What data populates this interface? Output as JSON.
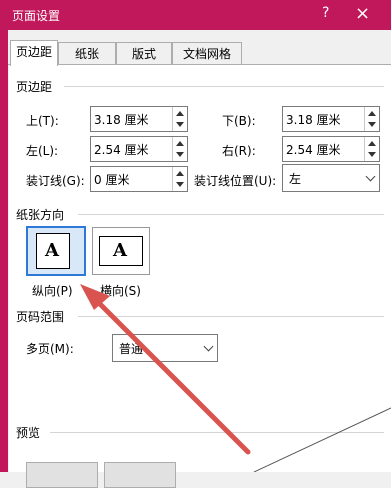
{
  "window": {
    "title": "页面设置",
    "help_glyph": "?",
    "close_glyph": "×"
  },
  "tabs": [
    {
      "label": "页边距",
      "active": true
    },
    {
      "label": "纸张",
      "active": false
    },
    {
      "label": "版式",
      "active": false
    },
    {
      "label": "文档网格",
      "active": false
    }
  ],
  "margins": {
    "group_label": "页边距",
    "top": {
      "label": "上(T):",
      "value": "3.18 厘米"
    },
    "bottom": {
      "label": "下(B):",
      "value": "3.18 厘米"
    },
    "left": {
      "label": "左(L):",
      "value": "2.54 厘米"
    },
    "right": {
      "label": "右(R):",
      "value": "2.54 厘米"
    },
    "gutter": {
      "label": "装订线(G):",
      "value": "0 厘米"
    },
    "gutter_pos": {
      "label": "装订线位置(U):",
      "value": "左"
    }
  },
  "orientation": {
    "group_label": "纸张方向",
    "portrait": {
      "label": "纵向(P)",
      "glyph": "A",
      "selected": true
    },
    "landscape": {
      "label": "横向(S)",
      "glyph": "A",
      "selected": false
    }
  },
  "pages": {
    "group_label": "页码范围",
    "multiple": {
      "label": "多页(M):",
      "value": "普通"
    }
  },
  "preview": {
    "group_label": "预览"
  },
  "colors": {
    "titlebar": "#c0185a",
    "annotation_arrow": "#d9534f",
    "selection": "#2d7ad6"
  }
}
